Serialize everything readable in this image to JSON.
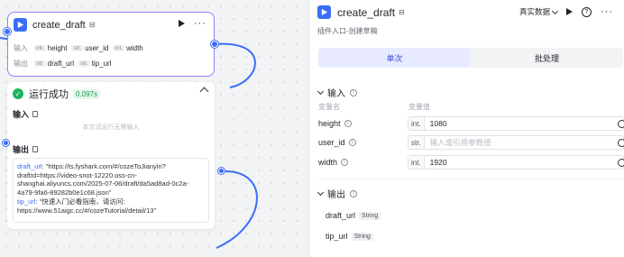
{
  "node": {
    "title": "create_draft",
    "input_label": "输入",
    "output_label": "输出",
    "inputs": [
      {
        "type": "int.",
        "name": "height"
      },
      {
        "type": "str.",
        "name": "user_id"
      },
      {
        "type": "int.",
        "name": "width"
      }
    ],
    "outputs": [
      {
        "type": "str.",
        "name": "draft_url"
      },
      {
        "type": "str.",
        "name": "tip_url"
      }
    ]
  },
  "result": {
    "status": "运行成功",
    "time": "0.097s",
    "input_title": "输入",
    "input_empty": "本次试运行无需输入",
    "output_title": "输出",
    "draft_url_key": "draft_url",
    "draft_url_value": ": \"https://ts.fyshark.com/#/cozeToJianyin?draftId=https://video-snot-12220.oss-cn-shanghai.aliyuncs.com/2025-07-06/draft/da5ad8ad-0c2a-4a79-9fa6-89282b0e1c68.json\"",
    "tip_url_key": "tip_url",
    "tip_url_value": ": \"快速入门必看指南，请访问: https://www.51aigc.cc/#/cozeTutorial/detail/13\""
  },
  "panel": {
    "title": "create_draft",
    "subtitle": "插件入口-创建草稿",
    "data_select": "真实数据",
    "tabs": [
      "单次",
      "批处理"
    ],
    "input_section": "输入",
    "col_name": "变量名",
    "col_value": "变量值",
    "inputs": [
      {
        "name": "height",
        "type": "int.",
        "value": "1080",
        "placeholder": ""
      },
      {
        "name": "user_id",
        "type": "str.",
        "value": "",
        "placeholder": "输入或引用参数值"
      },
      {
        "name": "width",
        "type": "int.",
        "value": "1920",
        "placeholder": ""
      }
    ],
    "output_section": "输出",
    "outputs": [
      {
        "name": "draft_url",
        "type": "String"
      },
      {
        "name": "tip_url",
        "type": "String"
      }
    ]
  },
  "colors": {
    "accent": "#3a6ef6",
    "selection": "#8f83f5",
    "success": "#1bb45a"
  }
}
